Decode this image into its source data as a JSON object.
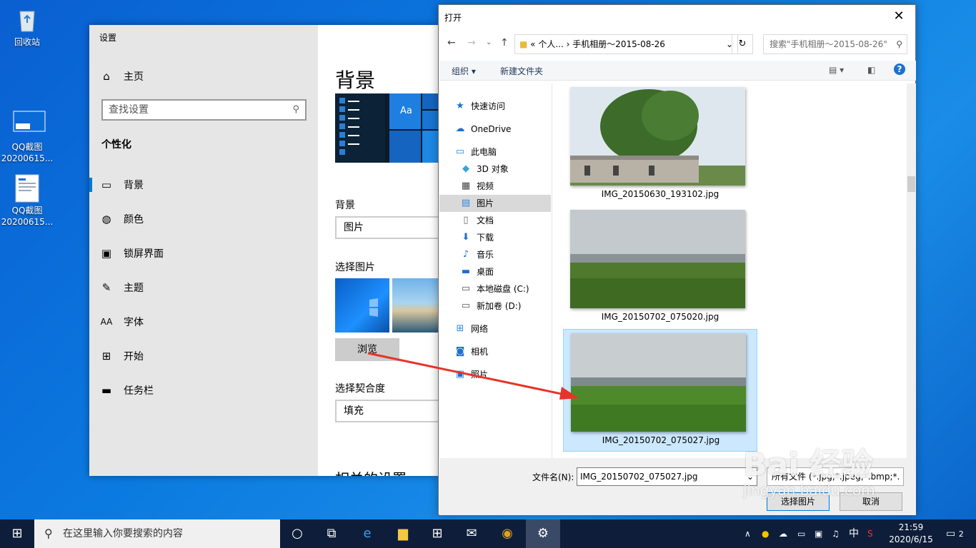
{
  "desktop": {
    "icons": [
      {
        "label": "回收站",
        "icon": "recycle-bin-icon"
      },
      {
        "label": "QQ截图\n20200615...",
        "icon": "image-file-icon"
      },
      {
        "label": "QQ截图\n20200615...",
        "icon": "image-file-icon"
      }
    ]
  },
  "settings": {
    "title": "设置",
    "home": "主页",
    "search_placeholder": "查找设置",
    "section": "个性化",
    "nav": [
      {
        "label": "背景",
        "icon": "picture-icon",
        "active": true
      },
      {
        "label": "颜色",
        "icon": "palette-icon"
      },
      {
        "label": "锁屏界面",
        "icon": "lock-screen-icon"
      },
      {
        "label": "主题",
        "icon": "theme-icon"
      },
      {
        "label": "字体",
        "icon": "font-icon"
      },
      {
        "label": "开始",
        "icon": "start-icon"
      },
      {
        "label": "任务栏",
        "icon": "taskbar-icon"
      }
    ],
    "main": {
      "heading": "背景",
      "preview_tile_text": "Aa",
      "bg_label": "背景",
      "bg_value": "图片",
      "choose_pic_label": "选择图片",
      "browse": "浏览",
      "fit_label": "选择契合度",
      "fit_value": "填充",
      "related": "相关的设置"
    }
  },
  "dialog": {
    "title": "打开",
    "address": "« 个人... › 手机相册～2015-08-26",
    "search_placeholder": "搜索\"手机相册～2015-08-26\"",
    "toolbar": {
      "organize": "组织 ▾",
      "new_folder": "新建文件夹"
    },
    "tree": [
      {
        "label": "快速访问",
        "icon": "star-icon"
      },
      {
        "label": "OneDrive",
        "icon": "cloud-icon"
      },
      {
        "label": "此电脑",
        "icon": "computer-icon"
      },
      {
        "label": "3D 对象",
        "icon": "cube-icon"
      },
      {
        "label": "视频",
        "icon": "video-icon"
      },
      {
        "label": "图片",
        "icon": "pictures-icon",
        "selected": true
      },
      {
        "label": "文档",
        "icon": "document-icon"
      },
      {
        "label": "下载",
        "icon": "download-icon"
      },
      {
        "label": "音乐",
        "icon": "music-icon"
      },
      {
        "label": "桌面",
        "icon": "desktop-icon"
      },
      {
        "label": "本地磁盘 (C:)",
        "icon": "drive-icon"
      },
      {
        "label": "新加卷 (D:)",
        "icon": "drive-icon"
      },
      {
        "label": "网络",
        "icon": "network-icon"
      },
      {
        "label": "相机",
        "icon": "camera-icon"
      },
      {
        "label": "照片",
        "icon": "photos-icon"
      }
    ],
    "files": [
      {
        "name": "IMG_20150630_193102.jpg"
      },
      {
        "name": "IMG_20150702_075020.jpg"
      },
      {
        "name": "IMG_20150702_075027.jpg",
        "selected": true
      }
    ],
    "filename_label": "文件名(N):",
    "filename_value": "IMG_20150702_075027.jpg",
    "filetype_value": "所有文件 (*.jpg;*.jpeg;*.bmp;*.",
    "open_button": "选择图片",
    "cancel_button": "取消"
  },
  "taskbar": {
    "search_placeholder": "在这里输入你要搜索的内容",
    "time": "21:59",
    "date": "2020/6/15",
    "notification_count": "2",
    "ime": "中"
  },
  "watermark": {
    "text": "Bai 经验",
    "url": "jingyan.baidu.com"
  }
}
